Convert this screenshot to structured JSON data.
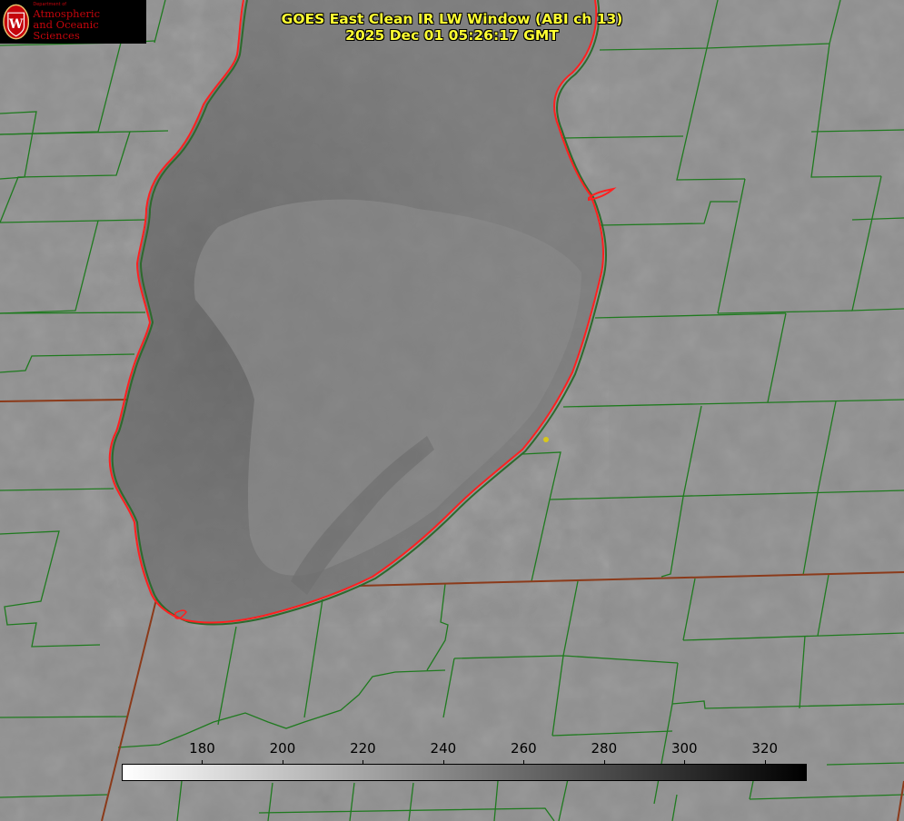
{
  "title": {
    "line1": "GOES East Clean IR LW Window (ABI ch 13)",
    "line2": "2025 Dec 01 05:26:17 GMT"
  },
  "logo": {
    "department_small": "Department of",
    "line1": "Atmospheric",
    "line2": "and Oceanic Sciences",
    "seal_letter": "W"
  },
  "colorbar": {
    "min": 160,
    "max": 330,
    "ticks": [
      "180",
      "200",
      "220",
      "240",
      "260",
      "280",
      "300",
      "320"
    ],
    "color_low": "#ffffff",
    "color_high": "#000000"
  },
  "colors": {
    "land": "#8f8f8f",
    "lake": "#7b7b7b",
    "lake_deep": "#666666",
    "county_lines": "#1f7a1f",
    "state_lines": "#8b3a1a",
    "shoreline": "#ff2020",
    "marker": "#d8c81a",
    "title_text": "#ffff33"
  }
}
